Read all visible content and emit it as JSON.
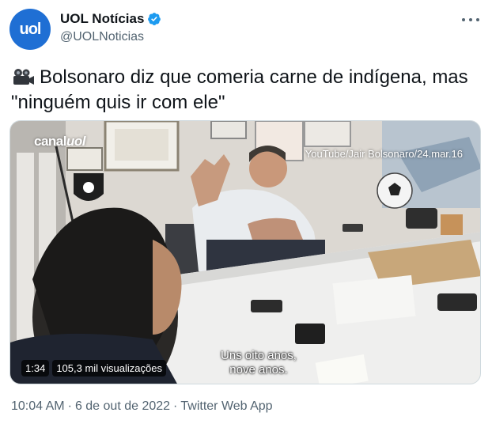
{
  "author": {
    "avatar_text": "uol",
    "display_name": "UOL Notícias",
    "handle": "@UOLNoticias",
    "verified": true
  },
  "tweet": {
    "emoji_icon": "movie-camera-icon",
    "text_line1": "Bolsonaro diz que comeria carne de indígena, mas",
    "text_line2": "\"ninguém quis ir com ele\""
  },
  "video": {
    "watermark_prefix": "canal",
    "watermark_brand": "uol",
    "source": "YouTube/Jair Bolsonaro/24.mar.16",
    "subtitle_line1": "Uns oito anos,",
    "subtitle_line2": "nove anos.",
    "duration": "1:34",
    "views": "105,3 mil visualizações"
  },
  "footer": {
    "time": "10:04 AM",
    "date": "6 de out de 2022",
    "separator": "·",
    "app": "Twitter Web App"
  },
  "colors": {
    "verified": "#1d9bf0",
    "avatar_bg": "#1f6fd4",
    "secondary_text": "#536471"
  }
}
